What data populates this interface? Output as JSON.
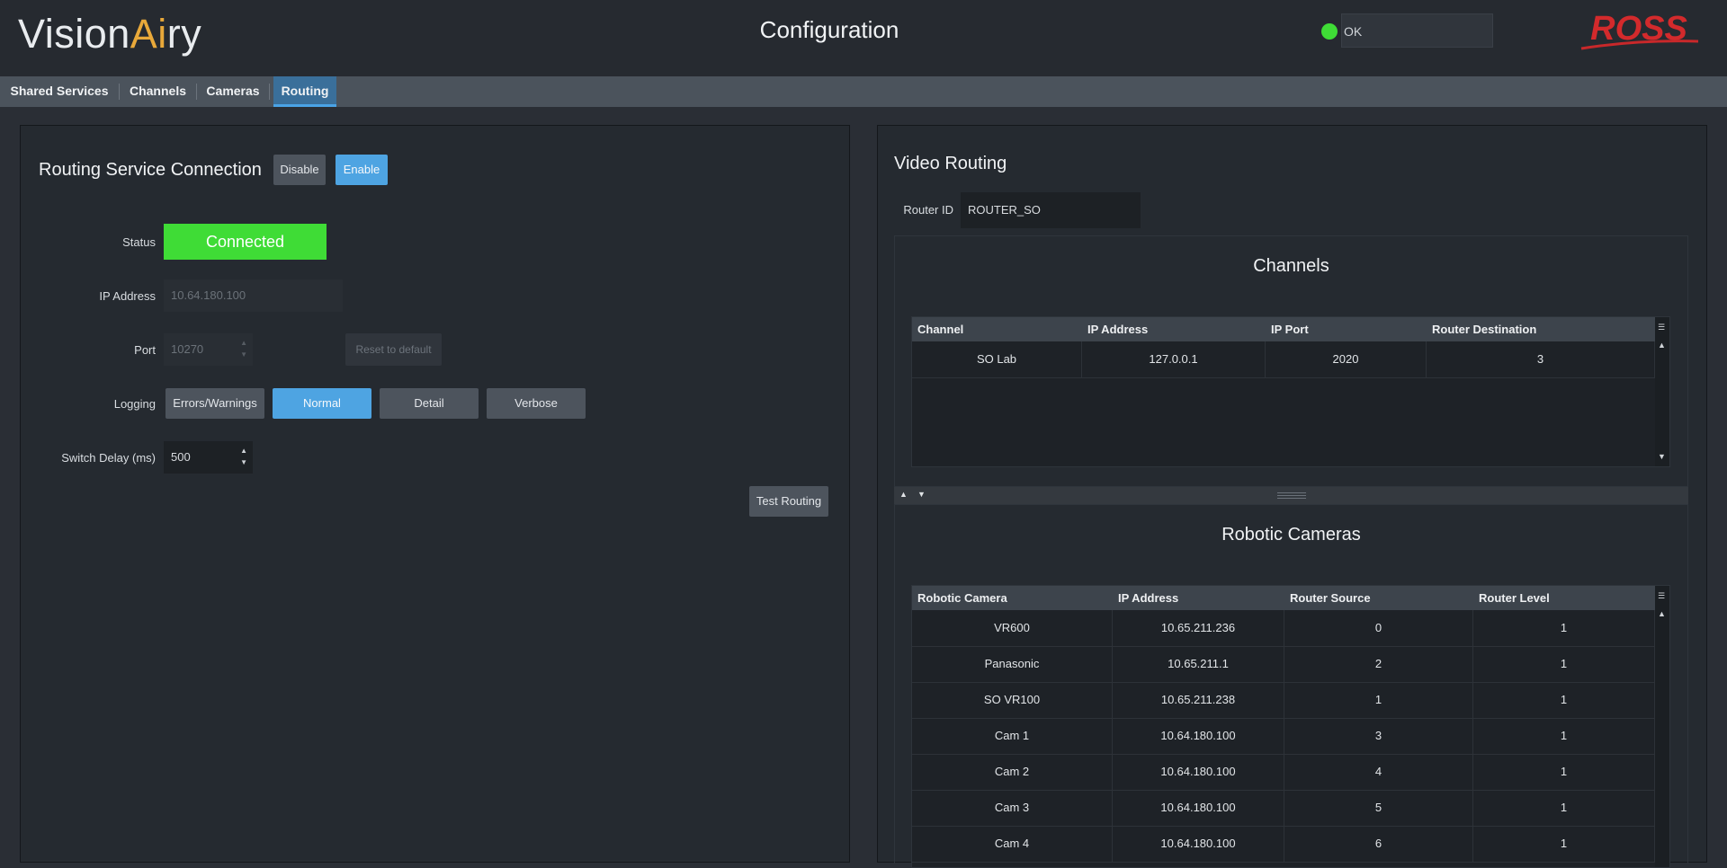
{
  "header": {
    "logo_text_1": "Vision",
    "logo_text_2": "A",
    "logo_text_3": "i",
    "logo_text_4": "ry",
    "title": "Configuration",
    "status_text": "OK",
    "brand": "ROSS",
    "status_color": "#3fdc36"
  },
  "tabs": [
    "Shared Services",
    "Channels",
    "Cameras",
    "Routing"
  ],
  "active_tab": "Routing",
  "left": {
    "title": "Routing Service Connection",
    "disable_label": "Disable",
    "enable_label": "Enable",
    "status_label": "Status",
    "status_value": "Connected",
    "ip_label": "IP Address",
    "ip_value": "10.64.180.100",
    "port_label": "Port",
    "port_value": "10270",
    "reset_label": "Reset to default",
    "logging_label": "Logging",
    "logging_options": [
      "Errors/Warnings",
      "Normal",
      "Detail",
      "Verbose"
    ],
    "logging_selected": "Normal",
    "delay_label": "Switch Delay (ms)",
    "delay_value": "500",
    "test_label": "Test Routing"
  },
  "right": {
    "title": "Video Routing",
    "router_id_label": "Router ID",
    "router_id_value": "ROUTER_SO",
    "channels": {
      "title": "Channels",
      "columns": [
        "Channel",
        "IP Address",
        "IP Port",
        "Router Destination"
      ],
      "rows": [
        [
          "SO Lab",
          "127.0.0.1",
          "2020",
          "3"
        ]
      ]
    },
    "cameras": {
      "title": "Robotic Cameras",
      "columns": [
        "Robotic Camera",
        "IP Address",
        "Router Source",
        "Router Level"
      ],
      "rows": [
        [
          "VR600",
          "10.65.211.236",
          "0",
          "1"
        ],
        [
          "Panasonic",
          "10.65.211.1",
          "2",
          "1"
        ],
        [
          "SO VR100",
          "10.65.211.238",
          "1",
          "1"
        ],
        [
          "Cam 1",
          "10.64.180.100",
          "3",
          "1"
        ],
        [
          "Cam 2",
          "10.64.180.100",
          "4",
          "1"
        ],
        [
          "Cam 3",
          "10.64.180.100",
          "5",
          "1"
        ],
        [
          "Cam 4",
          "10.64.180.100",
          "6",
          "1"
        ]
      ]
    }
  }
}
